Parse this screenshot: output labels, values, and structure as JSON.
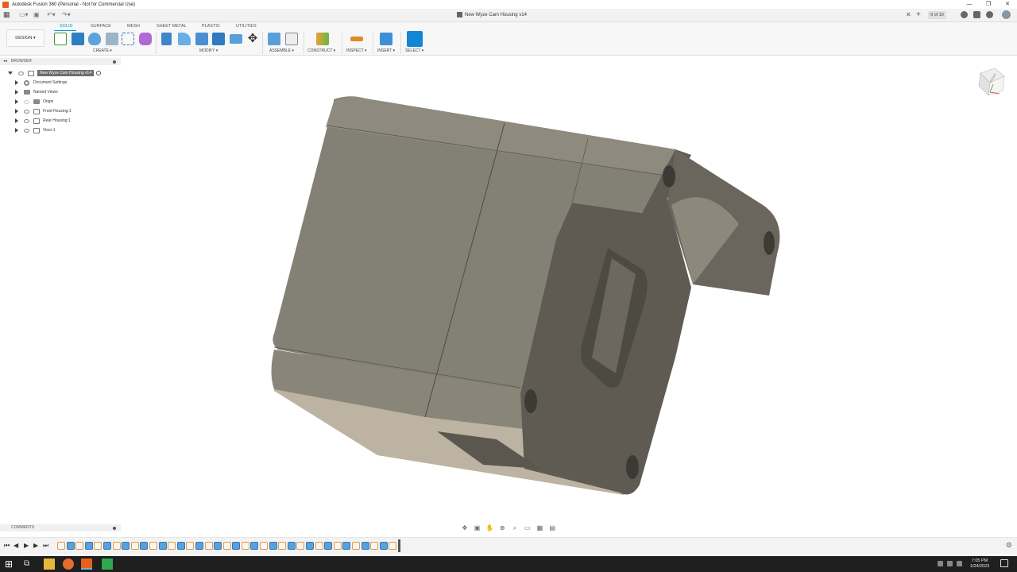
{
  "window": {
    "title": "Autodesk Fusion 360 (Personal - Not for Commercial Use)",
    "minimize": "—",
    "maximize": "❐",
    "close": "✕"
  },
  "quick_access": {
    "document_title": "New Wyze Cam Housing v14",
    "jobs": "9 of 10",
    "undo_icon": "undo-icon",
    "redo_icon": "redo-icon"
  },
  "workspace": {
    "label": "DESIGN ▾"
  },
  "tabs": [
    "SOLID",
    "SURFACE",
    "MESH",
    "SHEET METAL",
    "PLASTIC",
    "UTILITIES"
  ],
  "tool_groups": {
    "create": "CREATE ▾",
    "modify": "MODIFY ▾",
    "assemble": "ASSEMBLE ▾",
    "construct": "CONSTRUCT ▾",
    "inspect": "INSPECT ▾",
    "insert": "INSERT ▾",
    "select": "SELECT ▾"
  },
  "browser": {
    "header": "BROWSER",
    "root": "New Wyze Cam Housing v14",
    "items": [
      {
        "label": "Document Settings",
        "icon": "gear-icon"
      },
      {
        "label": "Named Views",
        "icon": "folder-icon"
      },
      {
        "label": "Origin",
        "icon": "folder-icon"
      },
      {
        "label": "Front Housing:1",
        "icon": "component-icon"
      },
      {
        "label": "Rear Housing:1",
        "icon": "component-icon"
      },
      {
        "label": "Visor:1",
        "icon": "component-icon"
      }
    ]
  },
  "viewcube": {
    "face_label": "RIGHT"
  },
  "comments": {
    "header": "COMMENTS"
  },
  "timeline": {
    "feature_count": 37
  },
  "taskbar": {
    "time": "7:05 PM",
    "date": "1/24/2023"
  },
  "colors": {
    "accent": "#0696d7",
    "model_top": "#8a857a",
    "model_side": "#7a7569",
    "model_bottom": "#bdb3a2",
    "model_dark": "#5e5a52"
  }
}
